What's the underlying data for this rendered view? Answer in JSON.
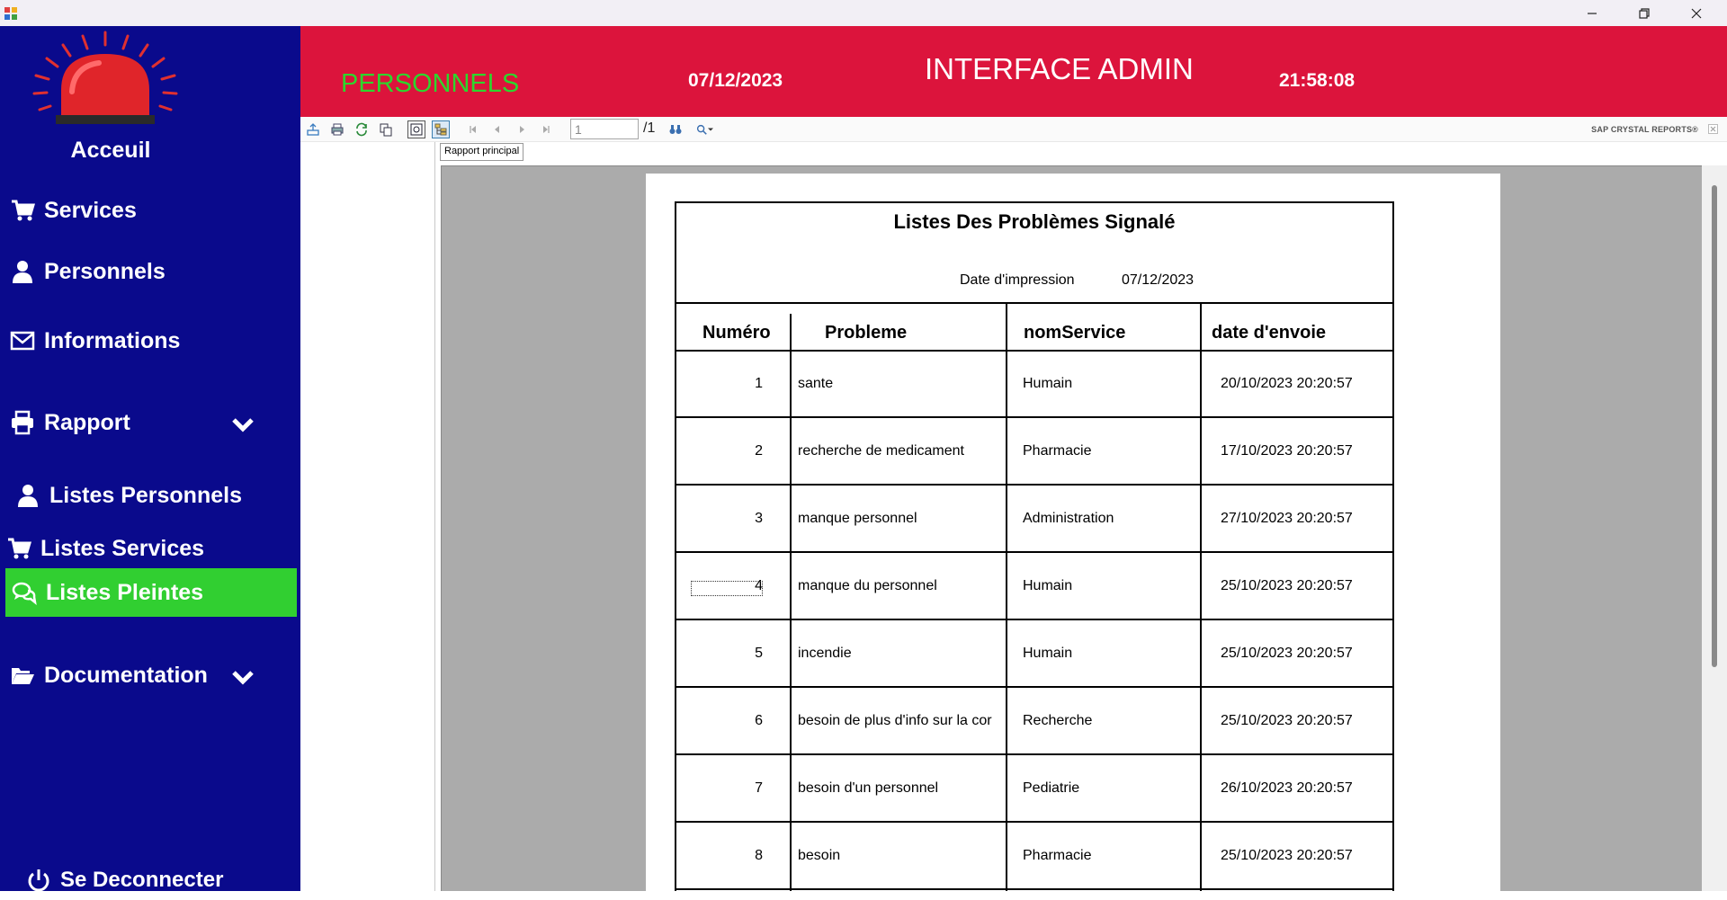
{
  "sidebar": {
    "home_label": "Acceuil",
    "items": [
      {
        "label": "Services",
        "icon": "cart-icon"
      },
      {
        "label": "Personnels",
        "icon": "user-icon"
      },
      {
        "label": "Informations",
        "icon": "envelope-icon"
      },
      {
        "label": "Rapport",
        "icon": "printer-icon"
      },
      {
        "label": "Listes Personnels",
        "icon": "user-icon"
      },
      {
        "label": "Listes Services",
        "icon": "cart-icon"
      },
      {
        "label": "Listes Pleintes",
        "icon": "chat-icon"
      },
      {
        "label": "Documentation",
        "icon": "folder-open-icon"
      }
    ],
    "logout_label": "Se Deconnecter",
    "active_color": "#31cf31",
    "background": "#0a0a8c"
  },
  "header": {
    "title": "PERSONNELS",
    "date": "07/12/2023",
    "admin": "INTERFACE ADMIN",
    "time": "21:58:08",
    "background": "#dc143c"
  },
  "viewer": {
    "page_value": "1",
    "page_total": "/1",
    "brand": "SAP CRYSTAL REPORTS®",
    "tab_label": "Rapport principal"
  },
  "report": {
    "title": "Listes Des Problèmes Signalé",
    "date_label": "Date d'impression",
    "date_value": "07/12/2023",
    "columns": [
      "Numéro",
      "Probleme",
      "nomService",
      "date d'envoie"
    ],
    "rows": [
      {
        "num": "1",
        "probleme": "sante",
        "service": "Humain",
        "date": "20/10/2023  20:20:57"
      },
      {
        "num": "2",
        "probleme": "recherche de medicament",
        "service": "Pharmacie",
        "date": "17/10/2023  20:20:57"
      },
      {
        "num": "3",
        "probleme": "manque personnel",
        "service": "Administration",
        "date": "27/10/2023  20:20:57"
      },
      {
        "num": "4",
        "probleme": "manque du personnel",
        "service": "Humain",
        "date": "25/10/2023  20:20:57"
      },
      {
        "num": "5",
        "probleme": "incendie",
        "service": "Humain",
        "date": "25/10/2023  20:20:57"
      },
      {
        "num": "6",
        "probleme": "besoin de plus d'info sur la cor",
        "service": "Recherche",
        "date": "25/10/2023  20:20:57"
      },
      {
        "num": "7",
        "probleme": "besoin d'un personnel",
        "service": "Pediatrie",
        "date": "26/10/2023  20:20:57"
      },
      {
        "num": "8",
        "probleme": "besoin",
        "service": "Pharmacie",
        "date": "25/10/2023  20:20:57"
      }
    ]
  }
}
